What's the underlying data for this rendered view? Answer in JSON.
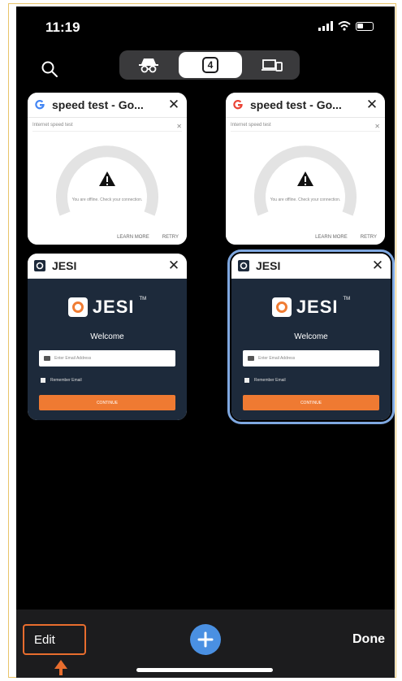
{
  "status_bar": {
    "time": "11:19"
  },
  "toolbar": {
    "tab_count": "4"
  },
  "tabs": [
    {
      "title": "speed test - Go...",
      "favicon": "google-icon",
      "preview": {
        "mini_title": "Internet speed test",
        "warning_text": "You are offline. Check your connection.",
        "footer_left": "LEARN MORE",
        "footer_right": "RETRY"
      }
    },
    {
      "title": "speed test - Go...",
      "favicon": "google-icon",
      "preview": {
        "mini_title": "Internet speed test",
        "warning_text": "You are offline. Check your connection.",
        "footer_left": "LEARN MORE",
        "footer_right": "RETRY"
      }
    },
    {
      "title": "JESI",
      "favicon": "jesi-icon",
      "preview": {
        "brand": "JESI",
        "trademark": "TM",
        "welcome": "Welcome",
        "email_placeholder": "Enter Email Address",
        "remember": "Remember Email",
        "button": "CONTINUE"
      }
    },
    {
      "title": "JESI",
      "favicon": "jesi-icon",
      "selected": true,
      "preview": {
        "brand": "JESI",
        "trademark": "TM",
        "welcome": "Welcome",
        "email_placeholder": "Enter Email Address",
        "remember": "Remember Email",
        "button": "CONTINUE"
      }
    }
  ],
  "bottom_bar": {
    "edit_label": "Edit",
    "done_label": "Done"
  },
  "colors": {
    "accent_blue": "#4a90e2",
    "highlight_orange": "#e86d2e",
    "jesi_orange": "#ef7a32",
    "jesi_navy": "#1d2a3b"
  }
}
